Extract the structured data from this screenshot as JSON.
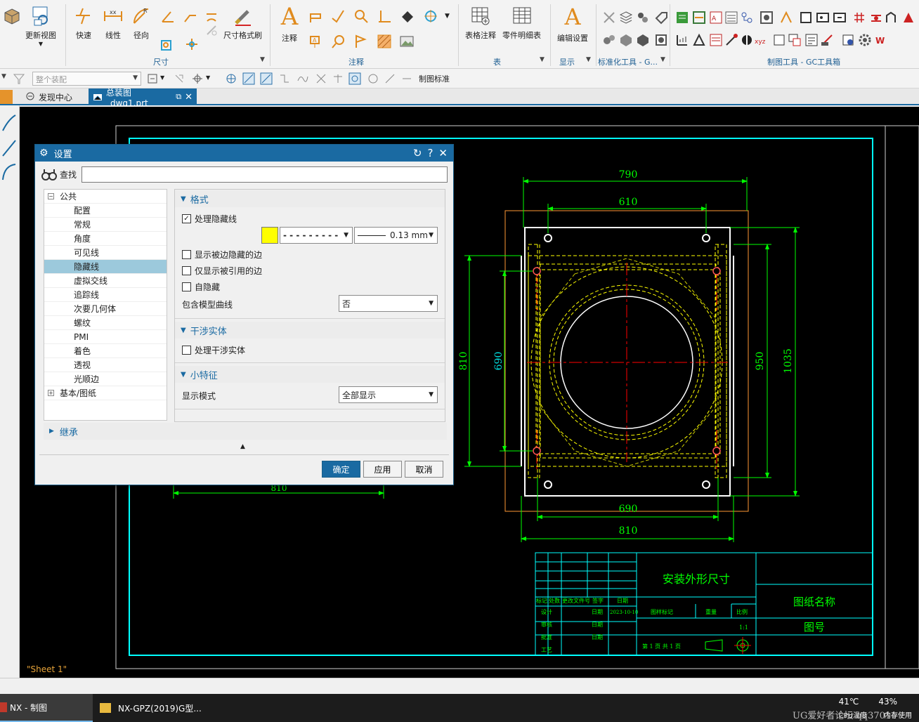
{
  "ribbon": {
    "buttons": {
      "update_view": "更新视图",
      "quick": "快速",
      "linear": "线性",
      "radial": "径向",
      "dim_painter": "尺寸格式刷",
      "note": "注释",
      "table_note": "表格注释",
      "parts_list": "零件明细表",
      "edit_settings": "编辑设置"
    },
    "groups": {
      "dimension": "尺寸",
      "annotation": "注释",
      "table": "表",
      "display": "显示",
      "std_tools": "标准化工具 - G...",
      "drafting_tools": "制图工具 - GC工具箱"
    }
  },
  "toolbar2": {
    "assembly_placeholder": "整个装配",
    "drafting_standard": "制图标准"
  },
  "tabs": [
    {
      "label": "发现中心"
    },
    {
      "label": "总装图_dwg1.prt"
    }
  ],
  "dialog": {
    "title": "设置",
    "find_label": "查找",
    "find_value": "",
    "tree": {
      "common": "公共",
      "items": [
        "配置",
        "常规",
        "角度",
        "可见线",
        "隐藏线",
        "虚拟交线",
        "追踪线",
        "次要几何体",
        "螺纹",
        "PMI",
        "着色",
        "透视",
        "光顺边"
      ],
      "selected": "隐藏线",
      "base_drawing": "基本/图纸"
    },
    "format": {
      "header": "格式",
      "process_hidden": "处理隐藏线",
      "process_hidden_checked": true,
      "color": "#ffff00",
      "line_font": "- - - - - - - - -",
      "line_width": "0.13 mm",
      "show_hidden_by_edges": "显示被边隐藏的边",
      "only_referenced_edges": "仅显示被引用的边",
      "self_hidden": "自隐藏",
      "include_model_curves_label": "包含模型曲线",
      "include_model_curves_value": "否"
    },
    "interference": {
      "header": "干涉实体",
      "process_interference": "处理干涉实体"
    },
    "small_features": {
      "header": "小特征",
      "display_mode_label": "显示模式",
      "display_mode_value": "全部显示"
    },
    "inherit": "继承",
    "buttons": {
      "ok": "确定",
      "apply": "应用",
      "cancel": "取消"
    }
  },
  "drawing": {
    "dim_790": "790",
    "dim_610": "610",
    "dim_810_left": "810",
    "dim_690_left": "690",
    "dim_950": "950",
    "dim_1035": "1035",
    "dim_690_bottom": "690",
    "dim_810_bottom": "810",
    "dim_810_hidden": "810",
    "title_block": {
      "title": "安装外形尺寸",
      "drawing_name": "图纸名称",
      "drawing_no": "图号",
      "date": "2023-10-10",
      "scale": "1:1",
      "row_labels": [
        "设计",
        "审核",
        "批准",
        "工艺"
      ],
      "header_labels": [
        "标记",
        "处数",
        "更改文件号",
        "签字",
        "日期"
      ],
      "mid_labels": [
        "图样标记",
        "重量",
        "比例"
      ],
      "date_label": "日期",
      "sheet_text": "第 1 页    共 1 页"
    },
    "sheet_label": "\"Sheet 1\""
  },
  "taskbar": {
    "task1": "NX - 制图",
    "task2": "NX-GPZ(2019)G型...",
    "temp": "41℃",
    "cpu_label": "CPU温度",
    "mem": "43%",
    "mem_label": "内存使用"
  },
  "watermark": "UG爱好者论坛 qq37011",
  "colors": {
    "accent": "#1a6aa2",
    "canvas": "#000000",
    "border_cyan": "#00ffff",
    "dim_green": "#00ff00",
    "hidden_yellow": "#ffff00",
    "center_red": "#ff0000",
    "outline_orange": "#ff9933"
  }
}
